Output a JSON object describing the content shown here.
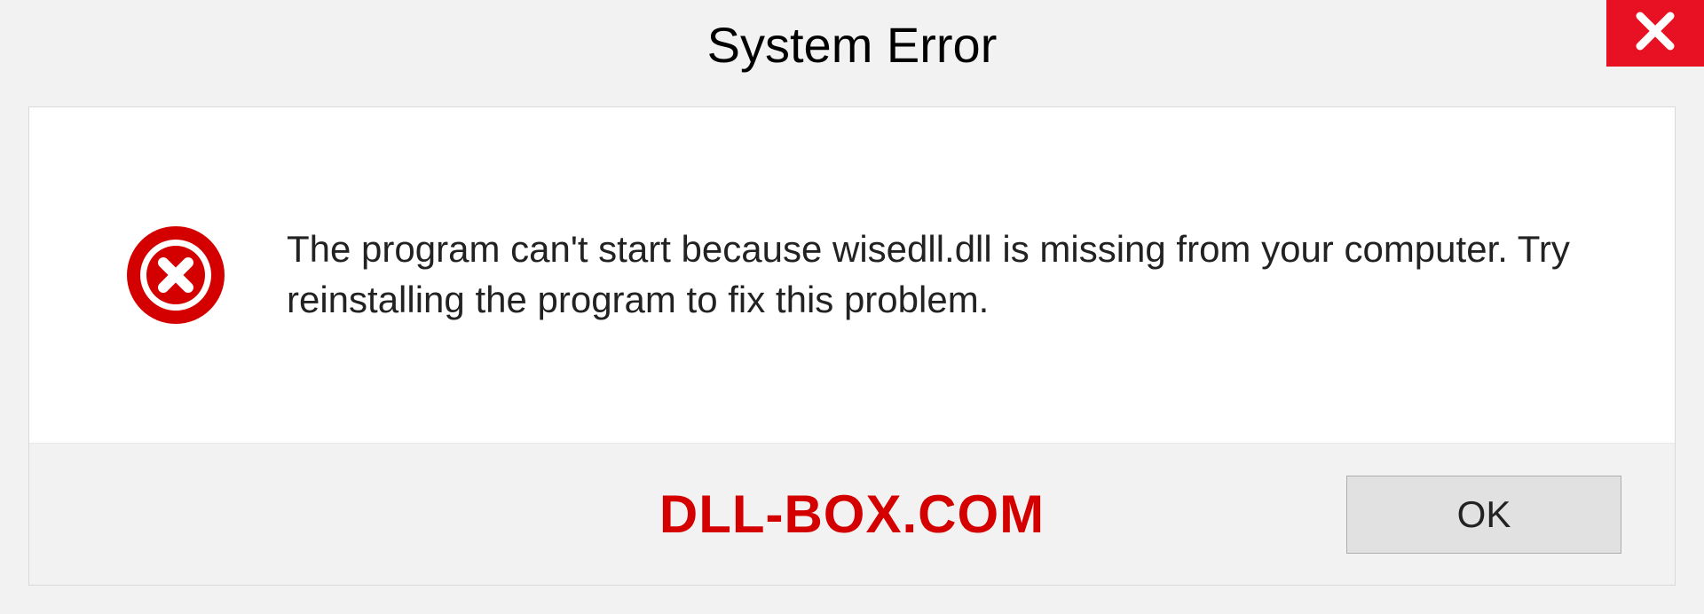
{
  "title": "System Error",
  "message": "The program can't start because wisedll.dll is missing from your computer. Try reinstalling the program to fix this problem.",
  "branding": "DLL-BOX.COM",
  "buttons": {
    "ok": "OK"
  },
  "colors": {
    "close_bg": "#e81123",
    "error_icon": "#d40000",
    "branding": "#d40000"
  }
}
